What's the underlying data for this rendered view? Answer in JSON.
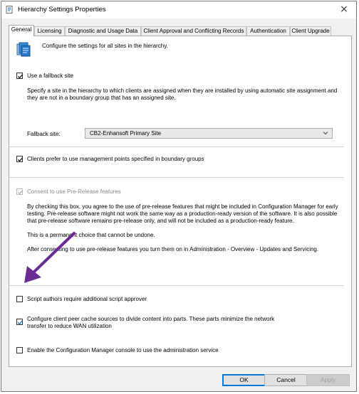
{
  "window": {
    "title": "Hierarchy Settings Properties",
    "close_glyph": "×"
  },
  "tabs": [
    {
      "label": "General",
      "active": true
    },
    {
      "label": "Licensing"
    },
    {
      "label": "Diagnostic and Usage Data"
    },
    {
      "label": "Client Approval and Conflicting Records"
    },
    {
      "label": "Authentication"
    },
    {
      "label": "Client Upgrade"
    }
  ],
  "general": {
    "header_icon": "hierarchy-settings-icon",
    "intro": "Configure the settings for all sites in the hierarchy.",
    "fallback": {
      "label": "Use a fallback site",
      "checked": true,
      "description": "Specify a site in the hierarchy to which clients are assigned when they are installed by using automatic site assignment and they are not in a boundary group that has an assigned site.",
      "site_label": "Fallback site:",
      "site_value": "CB2-Enhansoft Primary Site"
    },
    "management_points": {
      "label": "Clients prefer to use management points specified in boundary groups",
      "checked": true
    },
    "prerelease": {
      "label": "Consent to use Pre-Release features",
      "checked": true,
      "disabled": true,
      "description": "By checking this box, you agree to the use of pre-release features that might be included in Configuration Manager for early testing. Pre-release software might not work the same way as a production-ready version of the software. It is also possible that pre-release software remains pre-release only, and will not be included as a production-ready feature.",
      "permanent_note": "This is a permanent choice that cannot be undone.",
      "after_note": "After consenting to use pre-release features you turn them on in Administration - Overview - Updates and Servicing."
    },
    "script_approver": {
      "label": "Script authors require additional script approver",
      "checked": false
    },
    "peer_cache": {
      "label": "Configure client peer cache sources to divide content into parts. These parts minimize the network transfer to reduce WAN utilization",
      "checked": true
    },
    "admin_service": {
      "label": "Enable the Configuration Manager console to use the administration service",
      "checked": false
    }
  },
  "buttons": {
    "ok": "OK",
    "cancel": "Cancel",
    "apply": "Apply"
  },
  "colors": {
    "annotation_arrow": "#6a2c91",
    "checkbox_check": "#1a1a1a",
    "peer_cache_check": "#0078d7",
    "disabled_text": "#8a8a8a"
  }
}
